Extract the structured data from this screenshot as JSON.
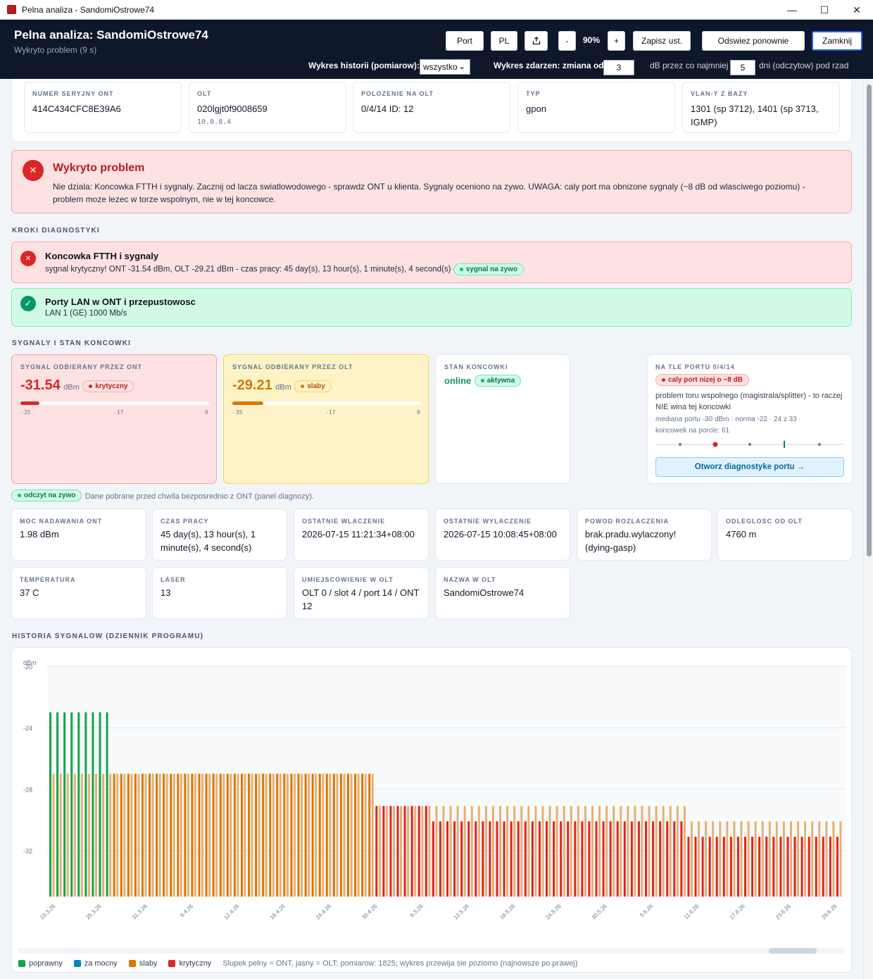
{
  "window": {
    "title": "Pelna analiza - SandomiOstrowe74",
    "min": "—",
    "max": "☐",
    "close": "✕"
  },
  "header": {
    "title": "Pelna analiza: SandomiOstrowe74",
    "subtitle": "Wykryto problem  (9 s)",
    "buttons": {
      "port": "Port",
      "lang": "PL",
      "minus": "-",
      "zoom": "90%",
      "plus": "+",
      "save": "Zapisz ust.",
      "refresh": "Odswiez ponownie",
      "close": "Zamknij"
    },
    "history_label": "Wykres historii (pomiarow):",
    "history_value": "wszystko",
    "events_label": "Wykres zdarzen: zmiana od",
    "events_change": "3",
    "events_mid": "dB przez co najmniej",
    "events_days": "5",
    "events_tail": "dni (odczytow) pod rzad"
  },
  "info": [
    {
      "label": "NUMER SERYJNY ONT",
      "value": "414C434CFC8E39A6",
      "sub": ""
    },
    {
      "label": "OLT",
      "value": "020lgjt0f9008659",
      "sub": "10.0.8.4"
    },
    {
      "label": "POLOZENIE NA OLT",
      "value": "0/4/14 ID: 12",
      "sub": ""
    },
    {
      "label": "TYP",
      "value": "gpon",
      "sub": ""
    },
    {
      "label": "VLAN-Y Z BAZY",
      "value": "1301 (sp 3712), 1401 (sp 3713, IGMP)",
      "sub": ""
    }
  ],
  "problem": {
    "icon": "✕",
    "title": "Wykryto problem",
    "text": "Nie dziala: Koncowka FTTH i sygnaly. Zacznij od lacza swiatlowodowego - sprawdz ONT u klienta. Sygnaly oceniono na zywo. UWAGA: caly port ma obnizone sygnaly (~8 dB od wlasciwego poziomu) - problem moze lezec w torze wspolnym, nie w tej koncowce."
  },
  "steps_title": "KROKI DIAGNOSTYKI",
  "steps": [
    {
      "icon": "✕",
      "title": "Koncowka FTTH i sygnaly",
      "text": "sygnal krytyczny! ONT -31.54 dBm, OLT -29.21 dBm - czas pracy: 45 day(s), 13 hour(s), 1 minute(s), 4 second(s)",
      "badge": "sygnal na zywo"
    },
    {
      "icon": "✓",
      "title": "Porty LAN w ONT i przepustowosc",
      "text": "LAN 1 (GE) 1000 Mb/s",
      "badge": ""
    }
  ],
  "signals_title": "SYGNALY I STAN KONCOWKI",
  "signals": {
    "ont": {
      "label": "SYGNAL ODBIERANY PRZEZ ONT",
      "value": "-31.54",
      "unit": "dBm",
      "badge": "krytyczny",
      "ticks": [
        "-35",
        "-17",
        "0"
      ],
      "level": 0.1
    },
    "olt": {
      "label": "SYGNAL ODBIERANY PRZEZ OLT",
      "value": "-29.21",
      "unit": "dBm",
      "badge": "slaby",
      "ticks": [
        "-35",
        "-17",
        "0"
      ],
      "level": 0.165
    },
    "state": {
      "label": "STAN KONCOWKI",
      "value": "online",
      "badge": "aktywna"
    },
    "port": {
      "label": "NA TLE PORTU 0/4/14",
      "badge": "caly port nizej o ~8 dB",
      "text": "problem toru wspolnego (magistrala/splitter) - to raczej NIE wina tej koncowki",
      "stats1": "mediana portu -30 dBm · norma -22 · 24 z 33 ·",
      "stats2": "koncowek na porcie: 61",
      "button": "Otworz diagnostyke portu →"
    }
  },
  "live": {
    "badge": "odczyt na zywo",
    "text": "Dane pobrane przed chwila bezposrednio z ONT (panel diagnozy)."
  },
  "details": [
    {
      "label": "MOC NADAWANIA ONT",
      "value": "1.98 dBm"
    },
    {
      "label": "CZAS PRACY",
      "value": "45 day(s), 13 hour(s), 1 minute(s), 4 second(s)"
    },
    {
      "label": "OSTATNIE WLACZENIE",
      "value": "2026-07-15 11:21:34+08:00"
    },
    {
      "label": "OSTATNIE WYLACZENIE",
      "value": "2026-07-15 10:08:45+08:00"
    },
    {
      "label": "POWOD ROZLACZENIA",
      "value": "brak.pradu.wylaczony! (dying-gasp)"
    },
    {
      "label": "ODLEGLOSC OD OLT",
      "value": "4760 m"
    },
    {
      "label": "TEMPERATURA",
      "value": "37 C"
    },
    {
      "label": "LASER",
      "value": "13"
    },
    {
      "label": "UMIEJSCOWIENIE W OLT",
      "value": "OLT 0 / slot 4 / port 14 / ONT 12"
    },
    {
      "label": "NAZWA W OLT",
      "value": "SandomiOstrowe74"
    }
  ],
  "history_title": "HISTORIA SYGNALOW (DZIENNIK PROGRAMU)",
  "colors": {
    "ok": "#16a34a",
    "strong": "#0284c7",
    "weak": "#d97706",
    "weak_light": "#e8b070",
    "crit": "#dc2626",
    "crit_light": "#e8b070"
  },
  "legend": {
    "ok": "poprawny",
    "strong": "za mocny",
    "weak": "slaby",
    "crit": "krytyczny",
    "note": "Slupek pelny = ONT, jasny = OLT; pomiarow: 1825; wykres przewija sie poziomo (najnowsze po prawej)"
  },
  "chart_data": {
    "type": "bar",
    "ylabel": "dBm",
    "yticks": [
      "-20",
      "-24",
      "-28",
      "-32"
    ],
    "ylim": [
      -35,
      -20
    ],
    "categories": [
      "19.3.26",
      "25.3.26",
      "31.3.26",
      "6.4.26",
      "12.4.26",
      "18.4.26",
      "24.4.26",
      "30.4.26",
      "6.5.26",
      "12.5.26",
      "18.5.26",
      "24.5.26",
      "30.5.26",
      "5.6.26",
      "11.6.26",
      "17.6.26",
      "23.6.26",
      "29.6.26"
    ],
    "series": [
      {
        "segments": [
          {
            "status": "poprawny",
            "ont": -23.0,
            "olt": -27.0,
            "count": 9
          },
          {
            "status": "slaby",
            "ont": -27.0,
            "olt": -27.0,
            "count": 37
          },
          {
            "status": "krytyczny",
            "ont": -29.1,
            "olt": -29.1,
            "count": 8
          },
          {
            "status": "krytyczny",
            "ont": -30.1,
            "olt": -29.1,
            "count": 36
          },
          {
            "status": "krytyczny",
            "ont": -31.1,
            "olt": -30.1,
            "count": 22
          }
        ]
      }
    ]
  }
}
